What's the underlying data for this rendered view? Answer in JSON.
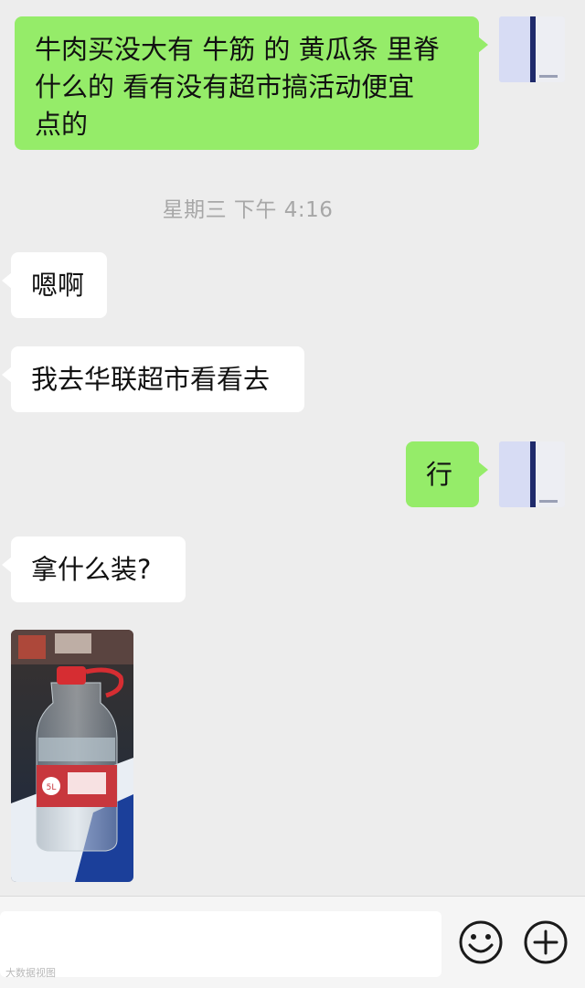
{
  "messages": [
    {
      "direction": "outgoing",
      "lines": [
        "牛肉买没大有 牛筋 的 黄瓜条 里脊",
        "什么的 看有没有超市搞活动便宜",
        "点的"
      ]
    },
    {
      "direction": "incoming",
      "text": "嗯啊"
    },
    {
      "direction": "incoming",
      "text": "我去华联超市看看去"
    },
    {
      "direction": "outgoing",
      "text": "行"
    },
    {
      "direction": "incoming",
      "text": "拿什么装?"
    }
  ],
  "timestamp": "星期三 下午 4:16",
  "photo": {
    "icon": "water-bottle-photo",
    "label_text": "5L"
  },
  "avatar": {
    "icon": "book-cover-avatar",
    "mark": "SOUND"
  },
  "input_bar": {
    "emoji_icon": "smiley-face-icon",
    "plus_icon": "plus-circle-icon"
  },
  "watermark": "大数据视图",
  "colors": {
    "background": "#ededed",
    "outgoing_bubble": "#95ec69",
    "incoming_bubble": "#ffffff",
    "timestamp": "#a7a7a7"
  }
}
